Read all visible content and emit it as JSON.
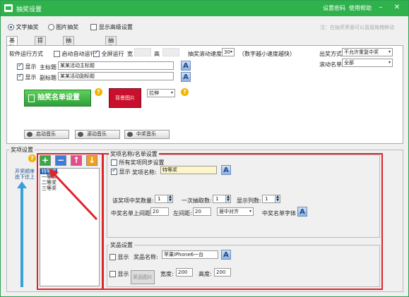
{
  "window": {
    "title": "抽奖设置",
    "links": [
      "设置密码",
      "使用帮助"
    ],
    "controls": [
      "minimize",
      "close"
    ]
  },
  "top_options": {
    "mode_text": "文字抽奖",
    "mode_image": "图片抽奖",
    "advanced": "显示高级设置",
    "hint": "注：在抽奖界面可以直接拖拽移动"
  },
  "tabs": [
    "基础设置",
    "提示设置",
    "抽奖结果页设置",
    "抽奖封面设置"
  ],
  "basic": {
    "run_mode_label": "软件运行方式",
    "auto_run": "启动自动运行",
    "fullscreen": "全屏运行",
    "width_label": "宽",
    "height_label": "高",
    "scroll_speed_label": "抽奖滚动速度",
    "scroll_speed_value": "30",
    "scroll_speed_hint": "（数字越小速度越快）",
    "show_label": "显示",
    "main_title_label": "主标题",
    "main_title_value": "某某活动主标题",
    "sub_title_label": "副标题",
    "sub_title_value": "某某活动副标题",
    "draw_method_label": "出奖方式",
    "draw_method_value": "不允许重复中奖",
    "roll_list_label": "滚动名单",
    "roll_list_value": "全部",
    "list_button": "抽奖名单设置",
    "bg_image": "背景图片",
    "stretch_value": "拉伸",
    "music": [
      "启动音乐",
      "滚动音乐",
      "中奖音乐"
    ]
  },
  "prize": {
    "group_label": "奖项设置",
    "drag_hint": "开奖顺序由下往上",
    "tool_icons": [
      "add-icon",
      "remove-icon",
      "move-up-icon",
      "move-down-icon"
    ],
    "items": [
      "特等奖",
      "一等奖",
      "二等奖",
      "三等奖"
    ],
    "list_settings_label": "奖项名称/名单设置",
    "sync_label": "所有奖项同步设置",
    "show_label": "显示",
    "prize_name_label": "奖项名称:",
    "prize_name_value": "特等奖",
    "winners_label": "该奖项中奖数量:",
    "winners_value": "1",
    "per_draw_label": "一次抽取数:",
    "per_draw_value": "1",
    "columns_label": "显示列数:",
    "columns_value": "1",
    "top_margin_label": "中奖名单上间距:",
    "top_margin_value": "20",
    "left_margin_label": "左间距:",
    "left_margin_value": "20",
    "align_value": "居中对齐",
    "font_label": "中奖名单字体"
  },
  "gift": {
    "group_label": "奖品设置",
    "show_label": "显示",
    "gift_name_label": "奖品名称:",
    "gift_name_value": "苹果iPhone6一台",
    "image_button": "奖品图片",
    "width_label": "宽度:",
    "width_value": "200",
    "height_label": "高度:",
    "height_value": "200"
  },
  "colors": {
    "titlebar": "#2fb24c",
    "annotation": "#e0242b",
    "accent": "#1a5fb4"
  }
}
